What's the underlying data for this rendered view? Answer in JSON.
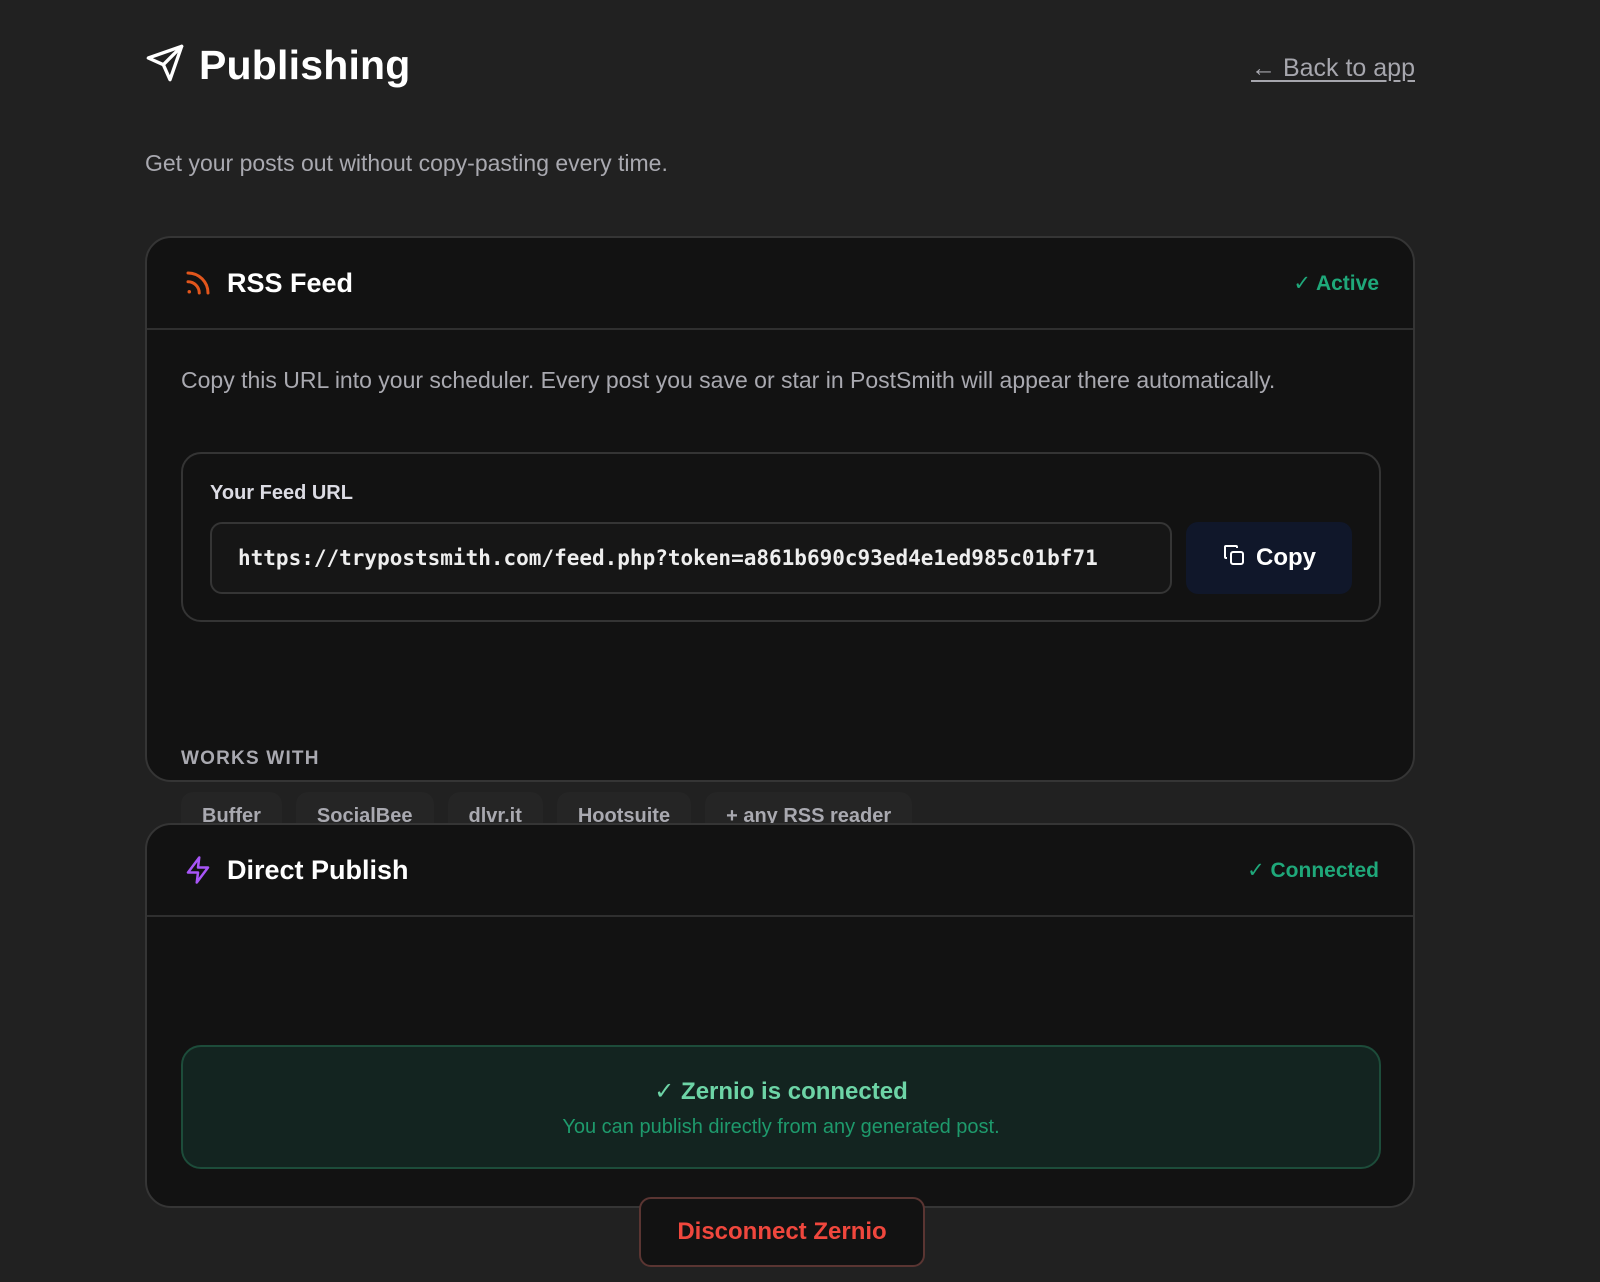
{
  "header": {
    "title": "Publishing",
    "back_link": "← Back to app",
    "subtitle": "Get your posts out without copy-pasting every time."
  },
  "rss_card": {
    "title": "RSS Feed",
    "status": "✓ Active",
    "description": "Copy this URL into your scheduler. Every post you save or star in PostSmith will appear there automatically.",
    "feed_label": "Your Feed URL",
    "feed_url": "https://trypostsmith.com/feed.php?token=a861b690c93ed4e1ed985c01bf71",
    "copy_label": "Copy",
    "works_with_label": "WORKS WITH",
    "works_with": [
      "Buffer",
      "SocialBee",
      "dlvr.it",
      "Hootsuite",
      "+ any RSS reader"
    ]
  },
  "direct_card": {
    "title": "Direct Publish",
    "status": "✓ Connected",
    "connected_title": "✓ Zernio is connected",
    "connected_sub": "You can publish directly from any generated post.",
    "disconnect_label": "Disconnect Zernio"
  },
  "icons": {
    "title_icon": "send-icon",
    "rss_icon": "rss-icon",
    "direct_icon": "lightning-icon",
    "copy_icon": "copy-icon"
  },
  "colors": {
    "background": "#212121",
    "card": "#121212",
    "success": "#1fa87a",
    "rss_orange": "#e2561c",
    "lightning_purple": "#a855f7",
    "danger": "#f0473d"
  }
}
